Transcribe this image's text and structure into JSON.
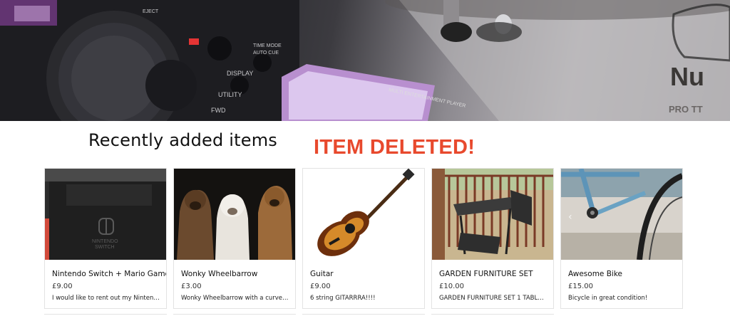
{
  "hero": {
    "image": "dj-turntable-banner",
    "deck_labels": [
      "DISPLAY",
      "UTILITY",
      "FWD",
      "TIME MODE AUTO CUE",
      "MULTI ENTERTAINMENT PLAYER",
      "PRO TT",
      "EJECT"
    ]
  },
  "section": {
    "title": "Recently added items"
  },
  "alert": {
    "text": "ITEM DELETED!",
    "color": "#e8492d"
  },
  "items": [
    {
      "name": "Nintendo Switch + Mario Game",
      "price": "£9.00",
      "description": "I would like to rent out my Nintendo ...",
      "image": "nintendo-switch-photo"
    },
    {
      "name": "Wonky Wheelbarrow",
      "price": "£3.00",
      "description": "Wonky Wheelbarrow with a curved ...",
      "image": "three-dogs-photo"
    },
    {
      "name": "Guitar",
      "price": "£9.00",
      "description": "6 string GITARRRA!!!!",
      "image": "acoustic-guitar-photo"
    },
    {
      "name": "GARDEN FURNITURE SET",
      "price": "£10.00",
      "description": "GARDEN FURNITURE SET 1 TABLE 2...",
      "image": "balcony-furniture-photo"
    },
    {
      "name": "Awesome Bike",
      "price": "£15.00",
      "description": "Bicycle in great condition!",
      "image": "bicycle-photo"
    }
  ]
}
